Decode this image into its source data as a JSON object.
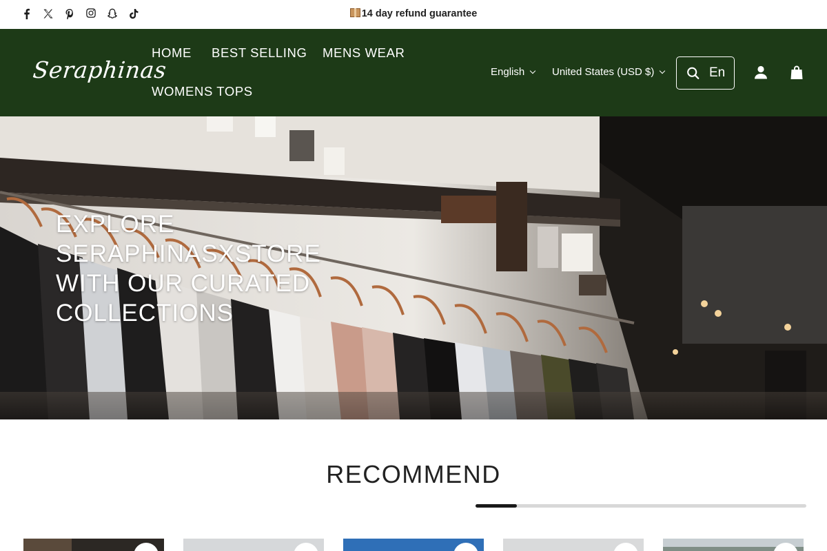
{
  "announcement": {
    "icon": "package-icon",
    "text": "14 day refund guarantee"
  },
  "social": [
    {
      "name": "facebook-icon"
    },
    {
      "name": "x-icon"
    },
    {
      "name": "pinterest-icon"
    },
    {
      "name": "instagram-icon"
    },
    {
      "name": "snapchat-icon"
    },
    {
      "name": "tiktok-icon"
    }
  ],
  "header": {
    "logo": "Seraphinas",
    "nav": [
      "HOME",
      "BEST SELLING",
      "MENS WEAR",
      "WOMENS TOPS"
    ],
    "language": "English",
    "country": "United States (USD $)",
    "search_value": "En",
    "icons": [
      "search-icon",
      "account-icon",
      "cart-icon"
    ]
  },
  "hero": {
    "lines": [
      "EXPLORE",
      "SERAPHINASXSTORE",
      "WITH OUR CURATED",
      "COLLECTIONS"
    ]
  },
  "recommend": {
    "title": "RECOMMEND",
    "scroll_progress": 0.125
  },
  "colors": {
    "header_bg": "#1d3a17",
    "text": "#222222"
  }
}
